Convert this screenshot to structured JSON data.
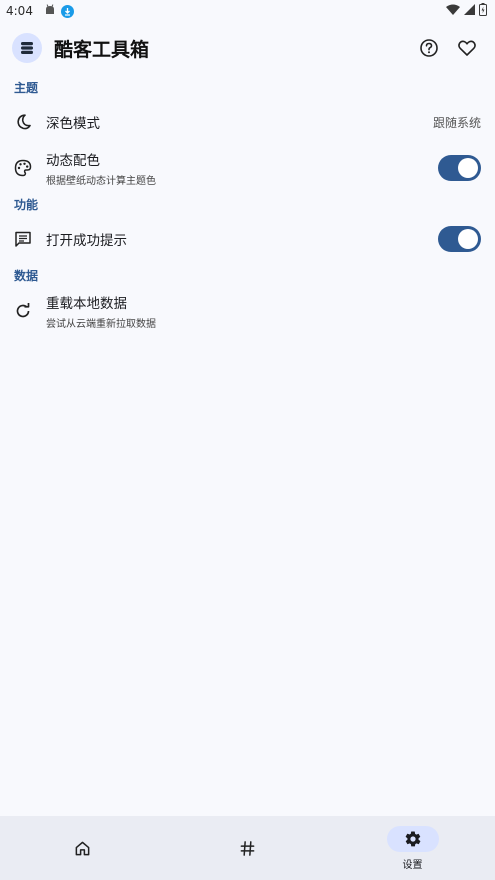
{
  "status_bar": {
    "time": "4:04"
  },
  "app_bar": {
    "title": "酷客工具箱"
  },
  "sections": {
    "theme": {
      "title": "主题",
      "dark_mode": {
        "title": "深色模式",
        "value": "跟随系统"
      },
      "dynamic_color": {
        "title": "动态配色",
        "subtitle": "根据壁纸动态计算主题色",
        "enabled": true
      }
    },
    "function": {
      "title": "功能",
      "success_tip": {
        "title": "打开成功提示",
        "enabled": true
      }
    },
    "data": {
      "title": "数据",
      "reload": {
        "title": "重载本地数据",
        "subtitle": "尝试从云端重新拉取数据"
      }
    }
  },
  "bottom_nav": {
    "items": [
      {
        "icon": "home-icon",
        "label": ""
      },
      {
        "icon": "hash-icon",
        "label": ""
      },
      {
        "icon": "gear-icon",
        "label": "设置",
        "active": true
      }
    ]
  },
  "colors": {
    "accent": "#2f5a92",
    "background": "#f8f9fd",
    "nav_background": "#eaecf3",
    "active_pill": "#d9e2ff"
  }
}
